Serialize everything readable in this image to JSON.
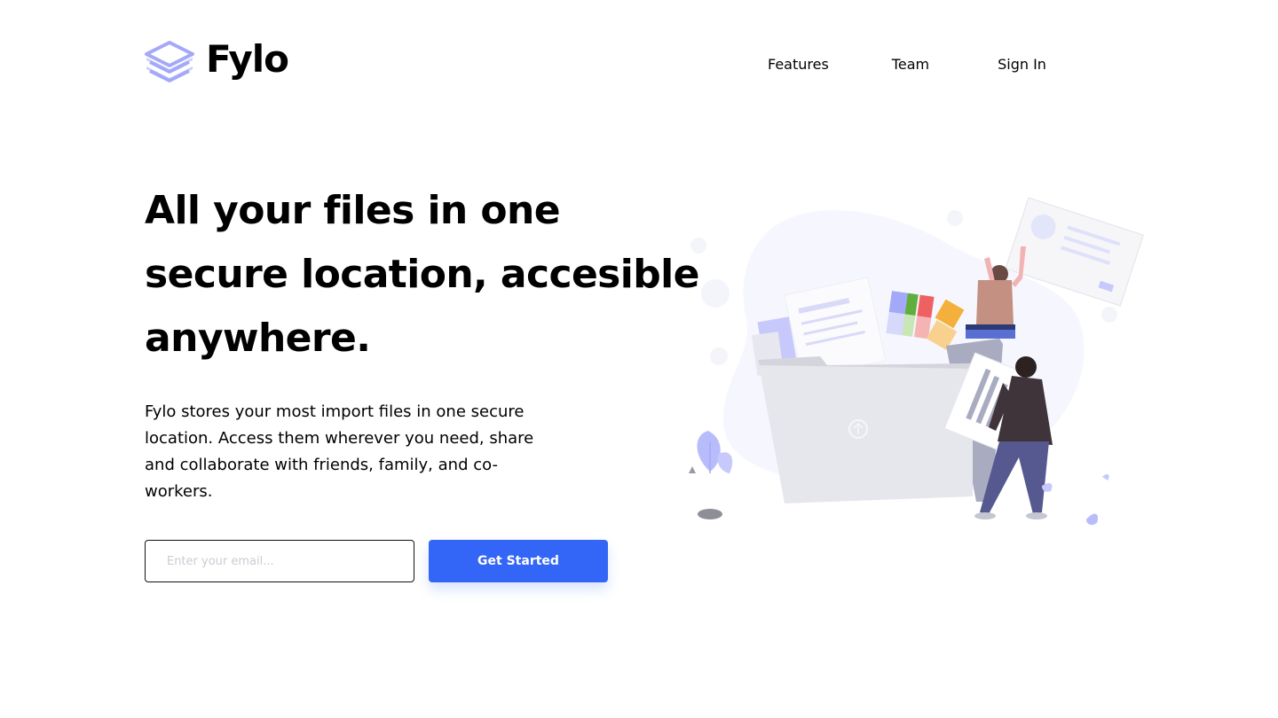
{
  "brand": {
    "name": "Fylo",
    "accent": "#a4a8f9"
  },
  "nav": {
    "items": [
      {
        "label": "Features"
      },
      {
        "label": "Team"
      },
      {
        "label": "Sign In"
      }
    ]
  },
  "hero": {
    "title": "All your files in one secure location, accesible anywhere.",
    "description": "Fylo stores your most import files in one secure location. Access them wherever you need, share and collaborate with friends, family, and co-workers."
  },
  "form": {
    "email_placeholder": "Enter your email...",
    "email_value": "",
    "button_label": "Get Started",
    "button_color": "#3366f6"
  },
  "illustration": {
    "icon": "file-upload-illustration"
  }
}
